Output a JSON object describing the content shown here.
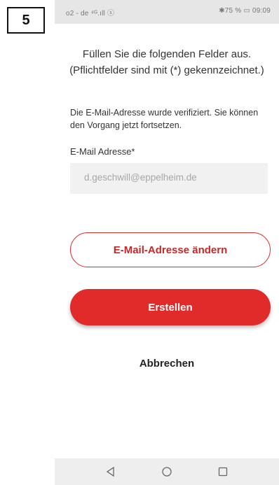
{
  "step": {
    "number": "5"
  },
  "status_bar": {
    "left_text": "o2 - de ⁴ᴳ.ıll ⓢ",
    "right_text": "✱75 % ▭ 09:09"
  },
  "form": {
    "instruction_line1": "Füllen Sie die folgenden Felder aus.",
    "instruction_line2": "(Pflichtfelder sind mit (*) gekennzeichnet.)",
    "verified_message": "Die E-Mail-Adresse wurde verifiziert. Sie können den Vorgang jetzt fortsetzen.",
    "email_label": "E-Mail Adresse*",
    "email_value": "d.geschwill@eppelheim.de"
  },
  "buttons": {
    "change_email": "E-Mail-Adresse ändern",
    "create": "Erstellen",
    "cancel": "Abbrechen"
  },
  "colors": {
    "accent_red": "#e12b2b",
    "field_bg": "#f1f1f1"
  },
  "nav_bar": {
    "icons": [
      "back-triangle-icon",
      "home-circle-icon",
      "recents-square-icon"
    ]
  }
}
